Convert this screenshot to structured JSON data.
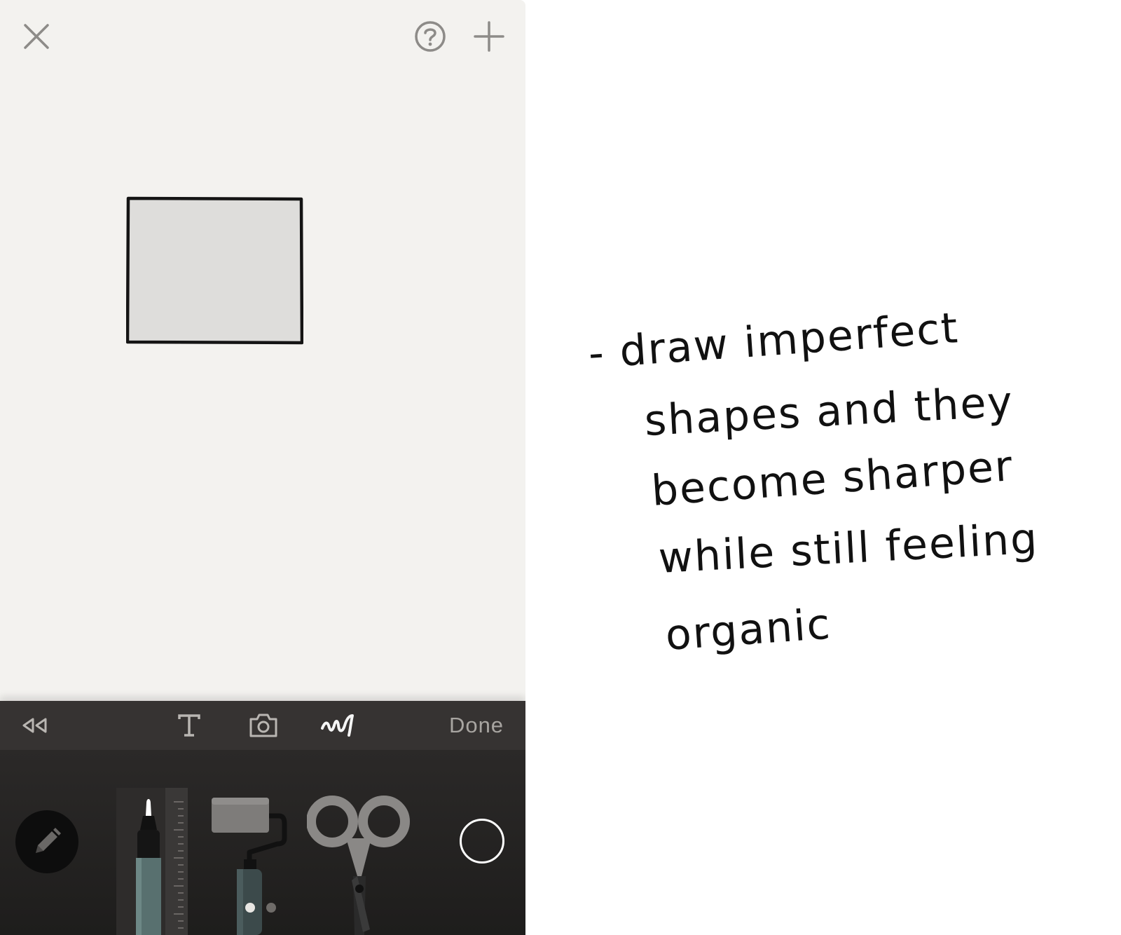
{
  "canvas": {
    "background": "#f3f2ef",
    "top_bar": {
      "close_icon": "close-icon",
      "help_icon": "help-icon",
      "add_icon": "plus-icon"
    },
    "shape": {
      "type": "rectangle",
      "fill": "#dedddb",
      "stroke": "#111111"
    }
  },
  "toolbar": {
    "rewind_icon": "rewind-icon",
    "text_icon": "text-icon",
    "camera_icon": "camera-icon",
    "draw_icon": "squiggle-icon",
    "done_label": "Done",
    "background": "#363332"
  },
  "tools": {
    "mode_icon": "pencil-icon",
    "items": [
      {
        "name": "marker",
        "icon": "marker-icon"
      },
      {
        "name": "roller",
        "icon": "roller-icon"
      },
      {
        "name": "scissors",
        "icon": "scissors-icon"
      }
    ],
    "current_color": "#000000",
    "page_dots": {
      "count": 2,
      "active": 1
    }
  },
  "note": {
    "lines": [
      "- draw imperfect",
      "shapes and they",
      "become sharper",
      "while still feeling",
      "organic"
    ]
  }
}
